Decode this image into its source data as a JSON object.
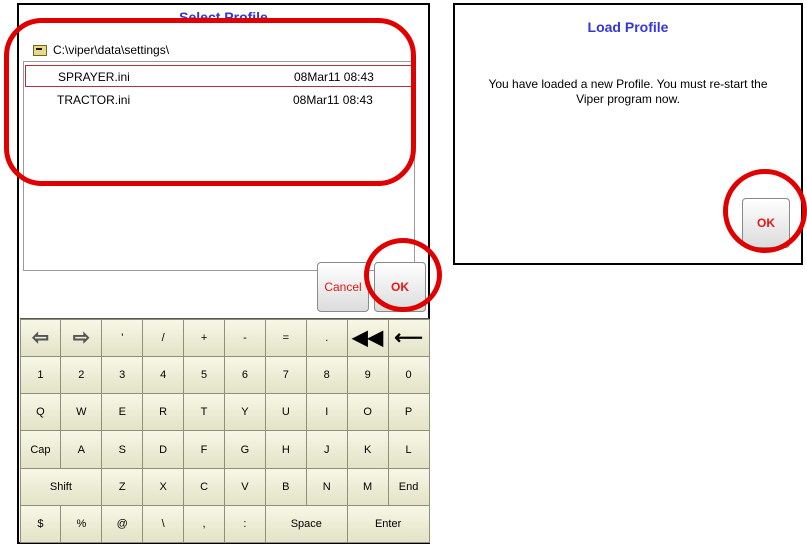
{
  "select_profile": {
    "title": "Select Profile",
    "path": "C:\\viper\\data\\settings\\",
    "files": [
      {
        "name": "SPRAYER.ini",
        "date": "08Mar11 08:43",
        "selected": true
      },
      {
        "name": "TRACTOR.ini",
        "date": "08Mar11 08:43",
        "selected": false
      }
    ],
    "cancel_label": "Cancel",
    "ok_label": "OK"
  },
  "keyboard": {
    "row1": [
      "arrow-left-outline",
      "arrow-right-outline",
      "'",
      "/",
      "+",
      "-",
      "=",
      ".",
      "double-arrow-left",
      "backspace-arrow"
    ],
    "row2": [
      "1",
      "2",
      "3",
      "4",
      "5",
      "6",
      "7",
      "8",
      "9",
      "0"
    ],
    "row3": [
      "Q",
      "W",
      "E",
      "R",
      "T",
      "Y",
      "U",
      "I",
      "O",
      "P"
    ],
    "row4": [
      "Cap",
      "A",
      "S",
      "D",
      "F",
      "G",
      "H",
      "J",
      "K",
      "L"
    ],
    "row5": [
      "Shift",
      "Z",
      "X",
      "C",
      "V",
      "B",
      "N",
      "M",
      "End"
    ],
    "row6": [
      "$",
      "%",
      "@",
      "\\",
      ",",
      ":",
      "Space",
      "Enter"
    ]
  },
  "load_profile": {
    "title": "Load Profile",
    "message": "You have loaded a new Profile. You must re-start the Viper program now.",
    "ok_label": "OK"
  },
  "colors": {
    "title_blue": "#3535d8",
    "button_text_red": "#e01818",
    "annotation_red": "#e00000"
  }
}
